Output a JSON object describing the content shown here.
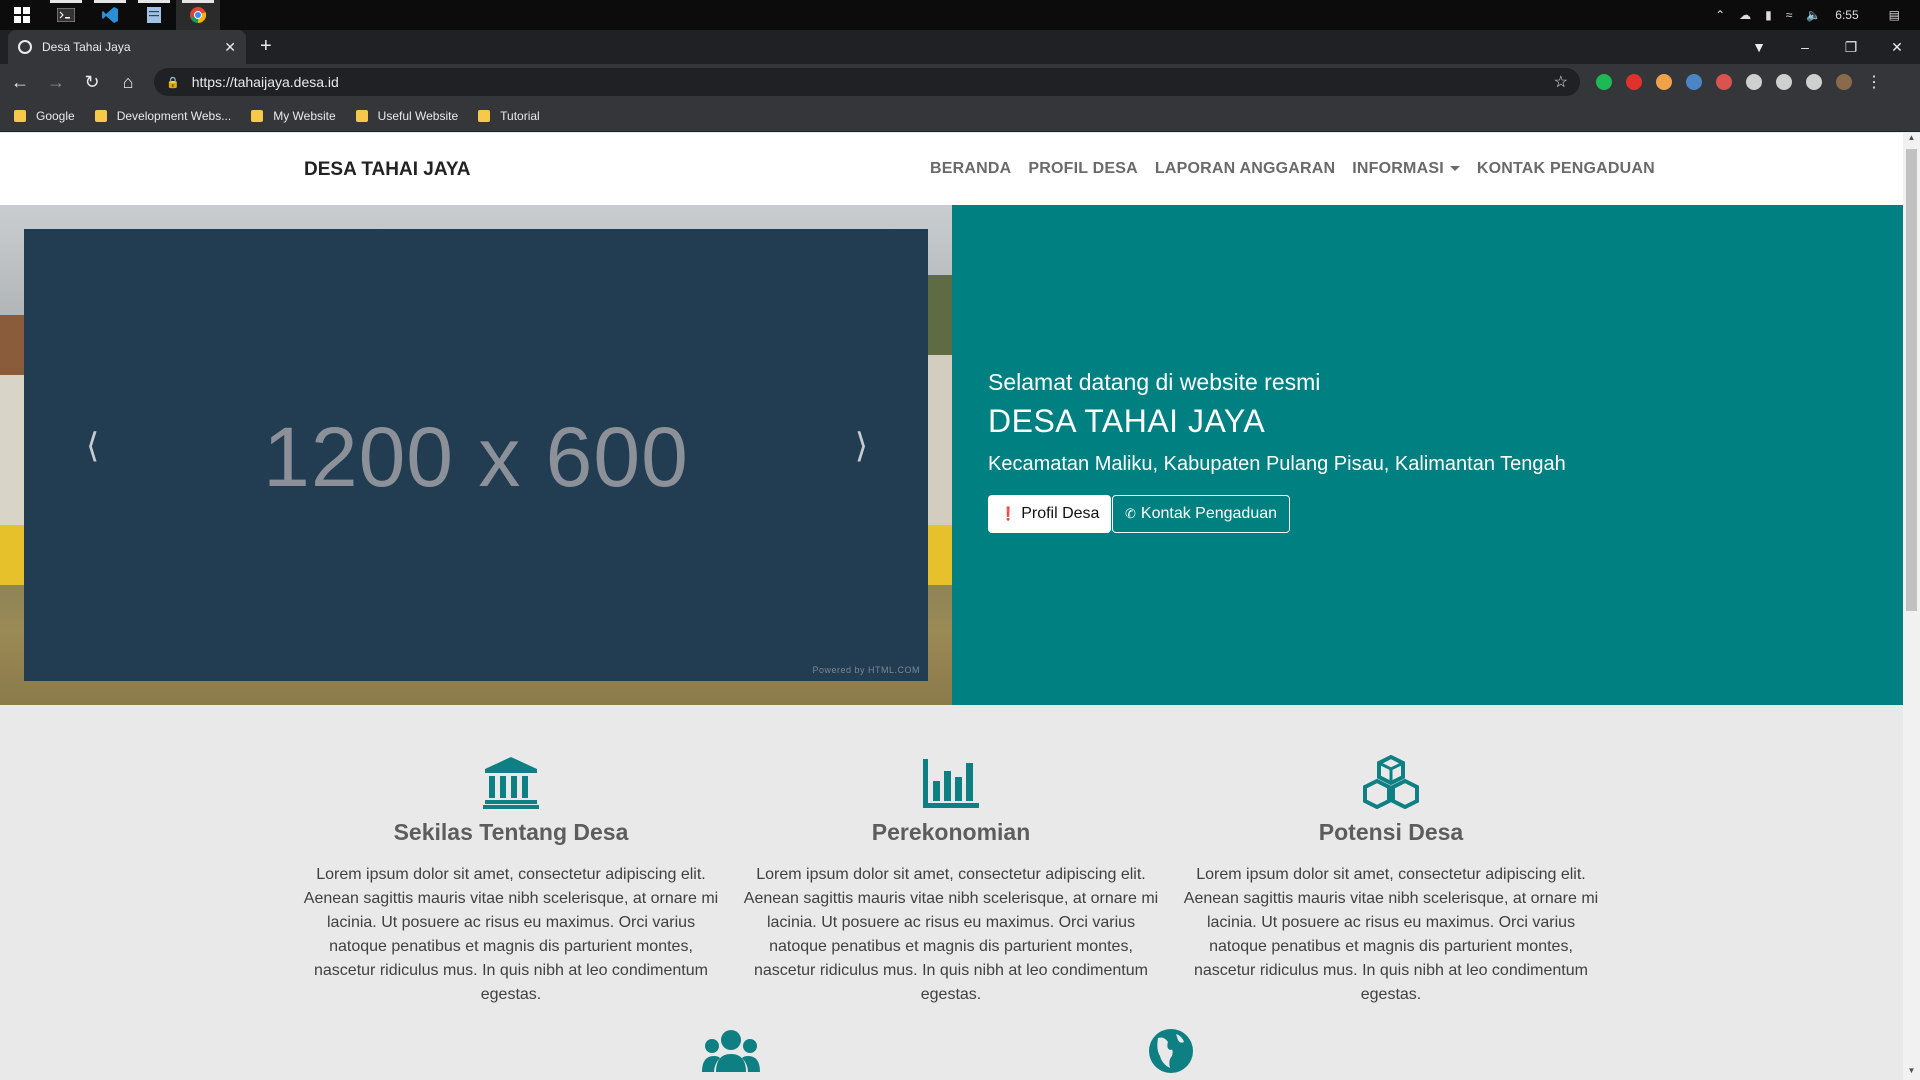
{
  "taskbar": {
    "time": "6:55"
  },
  "browser": {
    "tab_title": "Desa Tahai Jaya",
    "url": "https://tahaijaya.desa.id",
    "bookmarks": [
      "Google",
      "Development Webs...",
      "My Website",
      "Useful Website",
      "Tutorial"
    ],
    "ext_colors": [
      "#1db954",
      "#e0312b",
      "#f0a24a",
      "#4a86c5",
      "#d9534f",
      "#cfcfcf",
      "#cfcfcf",
      "#cfcfcf"
    ]
  },
  "site": {
    "brand": "DESA TAHAI JAYA",
    "menu": [
      "BERANDA",
      "PROFIL DESA",
      "LAPORAN ANGGARAN",
      "INFORMASI",
      "KONTAK PENGADUAN"
    ],
    "carousel": {
      "placeholder": "1200 x 600",
      "powered": "Powered by HTML.COM"
    },
    "hero": {
      "welcome": "Selamat datang di website resmi",
      "title": "DESA TAHAI JAYA",
      "subtitle": "Kecamatan Maliku, Kabupaten Pulang Pisau, Kalimantan Tengah",
      "btn_profile": "Profil Desa",
      "btn_contact": "Kontak Pengaduan"
    },
    "features": [
      {
        "title": "Sekilas Tentang Desa",
        "text": "Lorem ipsum dolor sit amet, consectetur adipiscing elit. Aenean sagittis mauris vitae nibh scelerisque, at ornare mi lacinia. Ut posuere ac risus eu maximus. Orci varius natoque penatibus et magnis dis parturient montes, nascetur ridiculus mus. In quis nibh at leo condimentum egestas.",
        "icon": "landmark-icon"
      },
      {
        "title": "Perekonomian",
        "text": "Lorem ipsum dolor sit amet, consectetur adipiscing elit. Aenean sagittis mauris vitae nibh scelerisque, at ornare mi lacinia. Ut posuere ac risus eu maximus. Orci varius natoque penatibus et magnis dis parturient montes, nascetur ridiculus mus. In quis nibh at leo condimentum egestas.",
        "icon": "bar-chart-icon"
      },
      {
        "title": "Potensi Desa",
        "text": "Lorem ipsum dolor sit amet, consectetur adipiscing elit. Aenean sagittis mauris vitae nibh scelerisque, at ornare mi lacinia. Ut posuere ac risus eu maximus. Orci varius natoque penatibus et magnis dis parturient montes, nascetur ridiculus mus. In quis nibh at leo condimentum egestas.",
        "icon": "cubes-icon"
      }
    ],
    "accent": "#008080"
  }
}
